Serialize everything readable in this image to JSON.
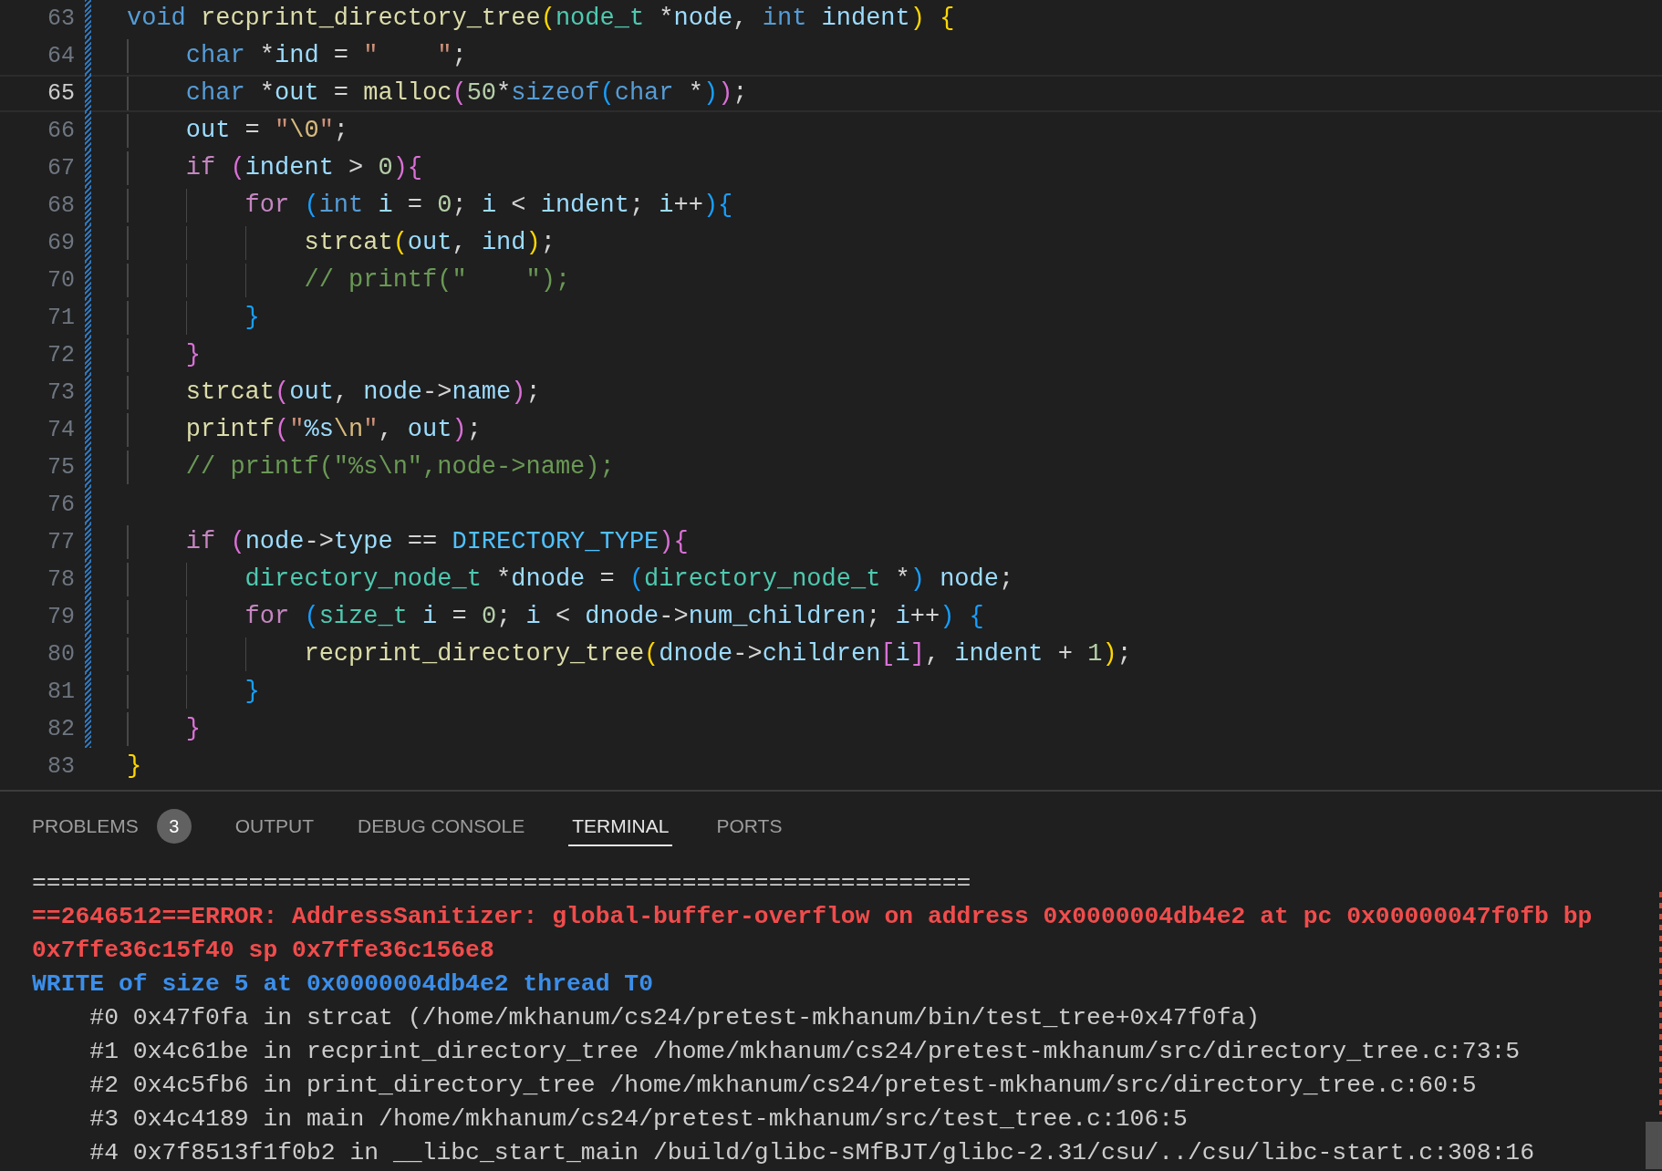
{
  "editor": {
    "lines": [
      {
        "number": "63",
        "current": false,
        "changed": true,
        "tokens": [
          {
            "kind": "storage",
            "text": "void "
          },
          {
            "kind": "func",
            "text": "recprint_directory_tree"
          },
          {
            "kind": "b1",
            "text": "("
          },
          {
            "kind": "type",
            "text": "node_t"
          },
          {
            "kind": "op",
            "text": " *"
          },
          {
            "kind": "var",
            "text": "node"
          },
          {
            "kind": "op",
            "text": ", "
          },
          {
            "kind": "storage",
            "text": "int "
          },
          {
            "kind": "var",
            "text": "indent"
          },
          {
            "kind": "b1",
            "text": ") {"
          }
        ]
      },
      {
        "number": "64",
        "current": false,
        "changed": true,
        "tokens": [
          {
            "kind": "storage",
            "text": "    char"
          },
          {
            "kind": "op",
            "text": " *"
          },
          {
            "kind": "var",
            "text": "ind"
          },
          {
            "kind": "op",
            "text": " = "
          },
          {
            "kind": "str",
            "text": "\"    \""
          },
          {
            "kind": "op",
            "text": ";"
          }
        ]
      },
      {
        "number": "65",
        "current": true,
        "changed": true,
        "tokens": [
          {
            "kind": "storage",
            "text": "    char"
          },
          {
            "kind": "op",
            "text": " *"
          },
          {
            "kind": "var",
            "text": "out"
          },
          {
            "kind": "op",
            "text": " = "
          },
          {
            "kind": "func",
            "text": "malloc"
          },
          {
            "kind": "b2",
            "text": "("
          },
          {
            "kind": "num",
            "text": "50"
          },
          {
            "kind": "op",
            "text": "*"
          },
          {
            "kind": "storage",
            "text": "sizeof"
          },
          {
            "kind": "b3",
            "text": "("
          },
          {
            "kind": "storage",
            "text": "char"
          },
          {
            "kind": "op",
            "text": " *"
          },
          {
            "kind": "b3",
            "text": ")"
          },
          {
            "kind": "b2",
            "text": ")"
          },
          {
            "kind": "op",
            "text": ";"
          }
        ]
      },
      {
        "number": "66",
        "current": false,
        "changed": true,
        "tokens": [
          {
            "kind": "var",
            "text": "    out"
          },
          {
            "kind": "op",
            "text": " = "
          },
          {
            "kind": "str",
            "text": "\""
          },
          {
            "kind": "esc",
            "text": "\\0"
          },
          {
            "kind": "str",
            "text": "\""
          },
          {
            "kind": "op",
            "text": ";"
          }
        ]
      },
      {
        "number": "67",
        "current": false,
        "changed": true,
        "tokens": [
          {
            "kind": "kw",
            "text": "    if "
          },
          {
            "kind": "b2",
            "text": "("
          },
          {
            "kind": "var",
            "text": "indent"
          },
          {
            "kind": "op",
            "text": " > "
          },
          {
            "kind": "num",
            "text": "0"
          },
          {
            "kind": "b2",
            "text": "){"
          }
        ]
      },
      {
        "number": "68",
        "current": false,
        "changed": true,
        "tokens": [
          {
            "kind": "kw",
            "text": "        for "
          },
          {
            "kind": "b3",
            "text": "("
          },
          {
            "kind": "storage",
            "text": "int "
          },
          {
            "kind": "var",
            "text": "i"
          },
          {
            "kind": "op",
            "text": " = "
          },
          {
            "kind": "num",
            "text": "0"
          },
          {
            "kind": "op",
            "text": "; "
          },
          {
            "kind": "var",
            "text": "i"
          },
          {
            "kind": "op",
            "text": " < "
          },
          {
            "kind": "var",
            "text": "indent"
          },
          {
            "kind": "op",
            "text": "; "
          },
          {
            "kind": "var",
            "text": "i"
          },
          {
            "kind": "op",
            "text": "++"
          },
          {
            "kind": "b3",
            "text": "){"
          }
        ]
      },
      {
        "number": "69",
        "current": false,
        "changed": true,
        "tokens": [
          {
            "kind": "func",
            "text": "            strcat"
          },
          {
            "kind": "b1",
            "text": "("
          },
          {
            "kind": "var",
            "text": "out"
          },
          {
            "kind": "op",
            "text": ", "
          },
          {
            "kind": "var",
            "text": "ind"
          },
          {
            "kind": "b1",
            "text": ")"
          },
          {
            "kind": "op",
            "text": ";"
          }
        ]
      },
      {
        "number": "70",
        "current": false,
        "changed": true,
        "tokens": [
          {
            "kind": "comment",
            "text": "            // printf(\"    \");"
          }
        ]
      },
      {
        "number": "71",
        "current": false,
        "changed": true,
        "tokens": [
          {
            "kind": "b3",
            "text": "        }"
          }
        ]
      },
      {
        "number": "72",
        "current": false,
        "changed": true,
        "tokens": [
          {
            "kind": "b2",
            "text": "    }"
          }
        ]
      },
      {
        "number": "73",
        "current": false,
        "changed": true,
        "tokens": [
          {
            "kind": "func",
            "text": "    strcat"
          },
          {
            "kind": "b2",
            "text": "("
          },
          {
            "kind": "var",
            "text": "out"
          },
          {
            "kind": "op",
            "text": ", "
          },
          {
            "kind": "var",
            "text": "node"
          },
          {
            "kind": "op",
            "text": "->"
          },
          {
            "kind": "var",
            "text": "name"
          },
          {
            "kind": "b2",
            "text": ")"
          },
          {
            "kind": "op",
            "text": ";"
          }
        ]
      },
      {
        "number": "74",
        "current": false,
        "changed": true,
        "tokens": [
          {
            "kind": "func",
            "text": "    printf"
          },
          {
            "kind": "b2",
            "text": "("
          },
          {
            "kind": "str",
            "text": "\""
          },
          {
            "kind": "fmt",
            "text": "%s"
          },
          {
            "kind": "esc",
            "text": "\\n"
          },
          {
            "kind": "str",
            "text": "\""
          },
          {
            "kind": "op",
            "text": ", "
          },
          {
            "kind": "var",
            "text": "out"
          },
          {
            "kind": "b2",
            "text": ")"
          },
          {
            "kind": "op",
            "text": ";"
          }
        ]
      },
      {
        "number": "75",
        "current": false,
        "changed": true,
        "tokens": [
          {
            "kind": "comment",
            "text": "    // printf(\"%s\\n\",node->name);"
          }
        ]
      },
      {
        "number": "76",
        "current": false,
        "changed": true
      },
      {
        "number": "77",
        "current": false,
        "changed": true,
        "tokens": [
          {
            "kind": "kw",
            "text": "    if "
          },
          {
            "kind": "b2",
            "text": "("
          },
          {
            "kind": "var",
            "text": "node"
          },
          {
            "kind": "op",
            "text": "->"
          },
          {
            "kind": "var",
            "text": "type"
          },
          {
            "kind": "op",
            "text": " == "
          },
          {
            "kind": "macro",
            "text": "DIRECTORY_TYPE"
          },
          {
            "kind": "b2",
            "text": "){"
          }
        ]
      },
      {
        "number": "78",
        "current": false,
        "changed": true,
        "tokens": [
          {
            "kind": "type",
            "text": "        directory_node_t"
          },
          {
            "kind": "op",
            "text": " *"
          },
          {
            "kind": "var",
            "text": "dnode"
          },
          {
            "kind": "op",
            "text": " = "
          },
          {
            "kind": "b3",
            "text": "("
          },
          {
            "kind": "type",
            "text": "directory_node_t"
          },
          {
            "kind": "op",
            "text": " *"
          },
          {
            "kind": "b3",
            "text": ") "
          },
          {
            "kind": "var",
            "text": "node"
          },
          {
            "kind": "op",
            "text": ";"
          }
        ]
      },
      {
        "number": "79",
        "current": false,
        "changed": true,
        "tokens": [
          {
            "kind": "kw",
            "text": "        for "
          },
          {
            "kind": "b3",
            "text": "("
          },
          {
            "kind": "type",
            "text": "size_t "
          },
          {
            "kind": "var",
            "text": "i"
          },
          {
            "kind": "op",
            "text": " = "
          },
          {
            "kind": "num",
            "text": "0"
          },
          {
            "kind": "op",
            "text": "; "
          },
          {
            "kind": "var",
            "text": "i"
          },
          {
            "kind": "op",
            "text": " < "
          },
          {
            "kind": "var",
            "text": "dnode"
          },
          {
            "kind": "op",
            "text": "->"
          },
          {
            "kind": "var",
            "text": "num_children"
          },
          {
            "kind": "op",
            "text": "; "
          },
          {
            "kind": "var",
            "text": "i"
          },
          {
            "kind": "op",
            "text": "++"
          },
          {
            "kind": "b3",
            "text": ") {"
          }
        ]
      },
      {
        "number": "80",
        "current": false,
        "changed": true,
        "tokens": [
          {
            "kind": "func",
            "text": "            recprint_directory_tree"
          },
          {
            "kind": "b1",
            "text": "("
          },
          {
            "kind": "var",
            "text": "dnode"
          },
          {
            "kind": "op",
            "text": "->"
          },
          {
            "kind": "var",
            "text": "children"
          },
          {
            "kind": "b2",
            "text": "["
          },
          {
            "kind": "var",
            "text": "i"
          },
          {
            "kind": "b2",
            "text": "]"
          },
          {
            "kind": "op",
            "text": ", "
          },
          {
            "kind": "var",
            "text": "indent"
          },
          {
            "kind": "op",
            "text": " + "
          },
          {
            "kind": "num",
            "text": "1"
          },
          {
            "kind": "b1",
            "text": ")"
          },
          {
            "kind": "op",
            "text": ";"
          }
        ]
      },
      {
        "number": "81",
        "current": false,
        "changed": true,
        "tokens": [
          {
            "kind": "b3",
            "text": "        }"
          }
        ]
      },
      {
        "number": "82",
        "current": false,
        "changed": true,
        "tokens": [
          {
            "kind": "b2",
            "text": "    }"
          }
        ]
      },
      {
        "number": "83",
        "current": false,
        "changed": false,
        "tokens": [
          {
            "kind": "b1",
            "text": "}"
          }
        ]
      }
    ]
  },
  "panel": {
    "tabs": [
      {
        "label": "PROBLEMS",
        "badge": "3",
        "selected": false
      },
      {
        "label": "OUTPUT",
        "selected": false
      },
      {
        "label": "DEBUG CONSOLE",
        "selected": false
      },
      {
        "label": "TERMINAL",
        "selected": true
      },
      {
        "label": "PORTS",
        "selected": false
      }
    ],
    "terminal": [
      {
        "kind": "rule",
        "text": "================================================================="
      },
      {
        "kind": "error",
        "text": "==2646512==ERROR: AddressSanitizer: global-buffer-overflow on address 0x0000004db4e2 at pc 0x00000047f0fb bp 0x7ffe36c15f40 sp 0x7ffe36c156e8"
      },
      {
        "kind": "info",
        "text": "WRITE of size 5 at 0x0000004db4e2 thread T0"
      },
      {
        "kind": "frame",
        "text": "#0 0x47f0fa in strcat (/home/mkhanum/cs24/pretest-mkhanum/bin/test_tree+0x47f0fa)"
      },
      {
        "kind": "frame",
        "text": "#1 0x4c61be in recprint_directory_tree /home/mkhanum/cs24/pretest-mkhanum/src/directory_tree.c:73:5"
      },
      {
        "kind": "frame",
        "text": "#2 0x4c5fb6 in print_directory_tree /home/mkhanum/cs24/pretest-mkhanum/src/directory_tree.c:60:5"
      },
      {
        "kind": "frame",
        "text": "#3 0x4c4189 in main /home/mkhanum/cs24/pretest-mkhanum/src/test_tree.c:106:5"
      },
      {
        "kind": "frame",
        "text": "#4 0x7f8513f1f0b2 in __libc_start_main /build/glibc-sMfBJT/glibc-2.31/csu/../csu/libc-start.c:308:16"
      }
    ]
  }
}
